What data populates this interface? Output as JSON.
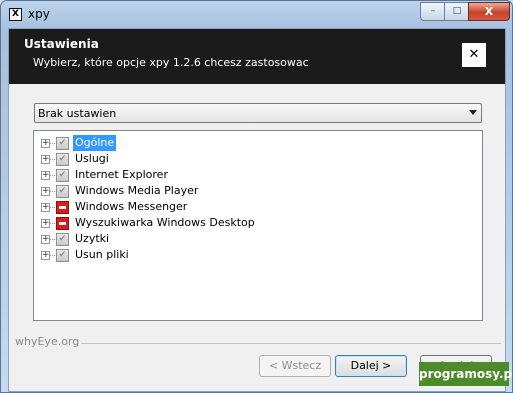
{
  "window": {
    "title": "xpy",
    "icon": "x-app-icon"
  },
  "title_controls": {
    "minimize": "–",
    "maximize": "□",
    "close": "X"
  },
  "header": {
    "title": "Ustawienia",
    "subtitle": "Wybierz, które opcje xpy 1.2.6 chcesz zastosowac",
    "close_glyph": "✕"
  },
  "preset": {
    "selected": "Brak ustawien"
  },
  "tree": {
    "items": [
      {
        "label": "Ogólne",
        "state": "checked-grey",
        "selected": true
      },
      {
        "label": "Uslugi",
        "state": "checked-grey",
        "selected": false
      },
      {
        "label": "Internet Explorer",
        "state": "checked-grey",
        "selected": false
      },
      {
        "label": "Windows Media Player",
        "state": "checked-grey",
        "selected": false
      },
      {
        "label": "Windows Messenger",
        "state": "red",
        "selected": false
      },
      {
        "label": "Wyszukiwarka Windows Desktop",
        "state": "red",
        "selected": false
      },
      {
        "label": "Uzytki",
        "state": "checked-grey",
        "selected": false
      },
      {
        "label": "Usun pliki",
        "state": "checked-grey",
        "selected": false
      }
    ],
    "expander_glyph": "+",
    "check_glyph": "✔"
  },
  "footer": {
    "brand": "whyEye.org"
  },
  "buttons": {
    "back": "< Wstecz",
    "next": "Dalej >",
    "cancel": "Anuluj"
  },
  "watermark": "programosy.pl",
  "colors": {
    "header_bg": "#1b1b1b",
    "selection": "#3399ff",
    "red_state": "#d81c1c",
    "watermark_bg": "#4d8a2a"
  }
}
